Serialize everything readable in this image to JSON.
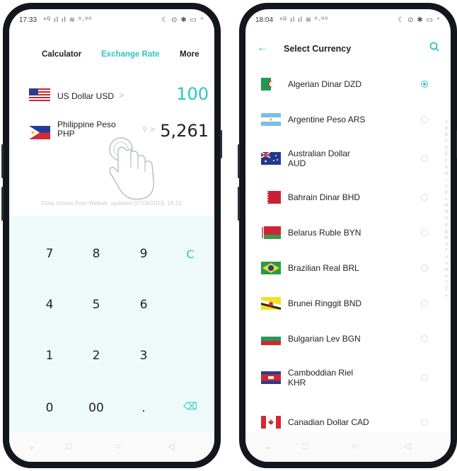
{
  "left": {
    "status": {
      "time": "17:33",
      "signal": "⁴ᴳ ıl ıl ≋ ⁰·⁰⁰",
      "right": "☾ ⊙ ✱ ▭ ⁺"
    },
    "tabs": [
      "Calculator",
      "Exchange Rate",
      "More"
    ],
    "active_tab": "Exchange Rate",
    "from": {
      "name": "US Dollar USD",
      "arrow": ">",
      "amount": "100"
    },
    "to": {
      "name_line1": "Philippine Peso",
      "name_line2": "PHP",
      "arrow": ">",
      "amount": "5,261"
    },
    "note": "Data comes from Webull, updated 07/16/2019, 16:51",
    "keys": [
      [
        "7",
        "8",
        "9",
        "C"
      ],
      [
        "4",
        "5",
        "6",
        ""
      ],
      [
        "1",
        "2",
        "3",
        ""
      ],
      [
        "0",
        "00",
        ".",
        "⌫"
      ]
    ]
  },
  "right": {
    "status": {
      "time": "18:04",
      "signal": "⁴ᴳ ıl ıl ≋ ⁰·⁰⁰",
      "right": "☾ ⊙ ✱ ▭ ⁺"
    },
    "header": {
      "title": "Select Currency"
    },
    "currencies": [
      {
        "line1": "Algerian Dinar DZD",
        "line2": "",
        "flag": "dz",
        "selected": true
      },
      {
        "line1": "Argentine Peso ARS",
        "line2": "",
        "flag": "ar",
        "selected": false
      },
      {
        "line1": "Australian Dollar",
        "line2": "AUD",
        "flag": "au",
        "selected": false
      },
      {
        "line1": "Bahrain Dinar BHD",
        "line2": "",
        "flag": "bh",
        "selected": false
      },
      {
        "line1": "Belarus Ruble BYN",
        "line2": "",
        "flag": "by",
        "selected": false
      },
      {
        "line1": "Brazilian Real BRL",
        "line2": "",
        "flag": "br",
        "selected": false
      },
      {
        "line1": "Brunei Ringgit BND",
        "line2": "",
        "flag": "bn",
        "selected": false
      },
      {
        "line1": "Bulgarian Lev BGN",
        "line2": "",
        "flag": "bg",
        "selected": false
      },
      {
        "line1": "Camboddian Riel",
        "line2": "KHR",
        "flag": "kh",
        "selected": false
      },
      {
        "line1": "Canadian Dollar CAD",
        "line2": "",
        "flag": "ca",
        "selected": false
      }
    ],
    "index_letters": [
      "#",
      "A",
      "B",
      "C",
      "D",
      "E",
      "F",
      "G",
      "H",
      "I",
      "J",
      "K",
      "L",
      "M",
      "N",
      "O",
      "P",
      "Q",
      "R",
      "S",
      "T",
      "U",
      "V",
      "W",
      "X",
      "Y",
      "Z",
      "#"
    ]
  },
  "colors": {
    "accent": "#29c6c9",
    "keypad_bg": "#eefafa",
    "phone_frame": "#14161d"
  }
}
